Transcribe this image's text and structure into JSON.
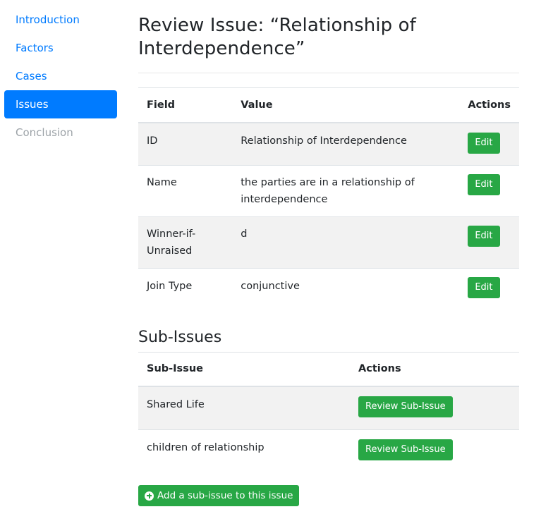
{
  "sidebar": {
    "items": [
      {
        "label": "Introduction"
      },
      {
        "label": "Factors"
      },
      {
        "label": "Cases"
      },
      {
        "label": "Issues"
      },
      {
        "label": "Conclusion"
      }
    ]
  },
  "page": {
    "title_line1": "Review Issue: “Relationship of",
    "title_line2": "Interdependence”"
  },
  "issue_table": {
    "headers": {
      "field": "Field",
      "value": "Value",
      "actions": "Actions"
    },
    "rows": [
      {
        "field": "ID",
        "value": "Relationship of Interdependence",
        "action": "Edit"
      },
      {
        "field": "Name",
        "value": "the parties are in a relationship of interdependence",
        "action": "Edit"
      },
      {
        "field": "Winner-if-Unraised",
        "value": "d",
        "action": "Edit"
      },
      {
        "field": "Join Type",
        "value": "conjunctive",
        "action": "Edit"
      }
    ]
  },
  "sub_issues": {
    "title": "Sub-Issues",
    "headers": {
      "sub_issue": "Sub-Issue",
      "actions": "Actions"
    },
    "rows": [
      {
        "name": "Shared Life",
        "action": "Review Sub-Issue"
      },
      {
        "name": "children of relationship",
        "action": "Review Sub-Issue"
      }
    ],
    "add_button": "Add a sub-issue to this issue"
  },
  "colors": {
    "primary": "#007bff",
    "success": "#28a745",
    "stripe": "#f2f2f2",
    "disabled": "#9da3a8"
  }
}
